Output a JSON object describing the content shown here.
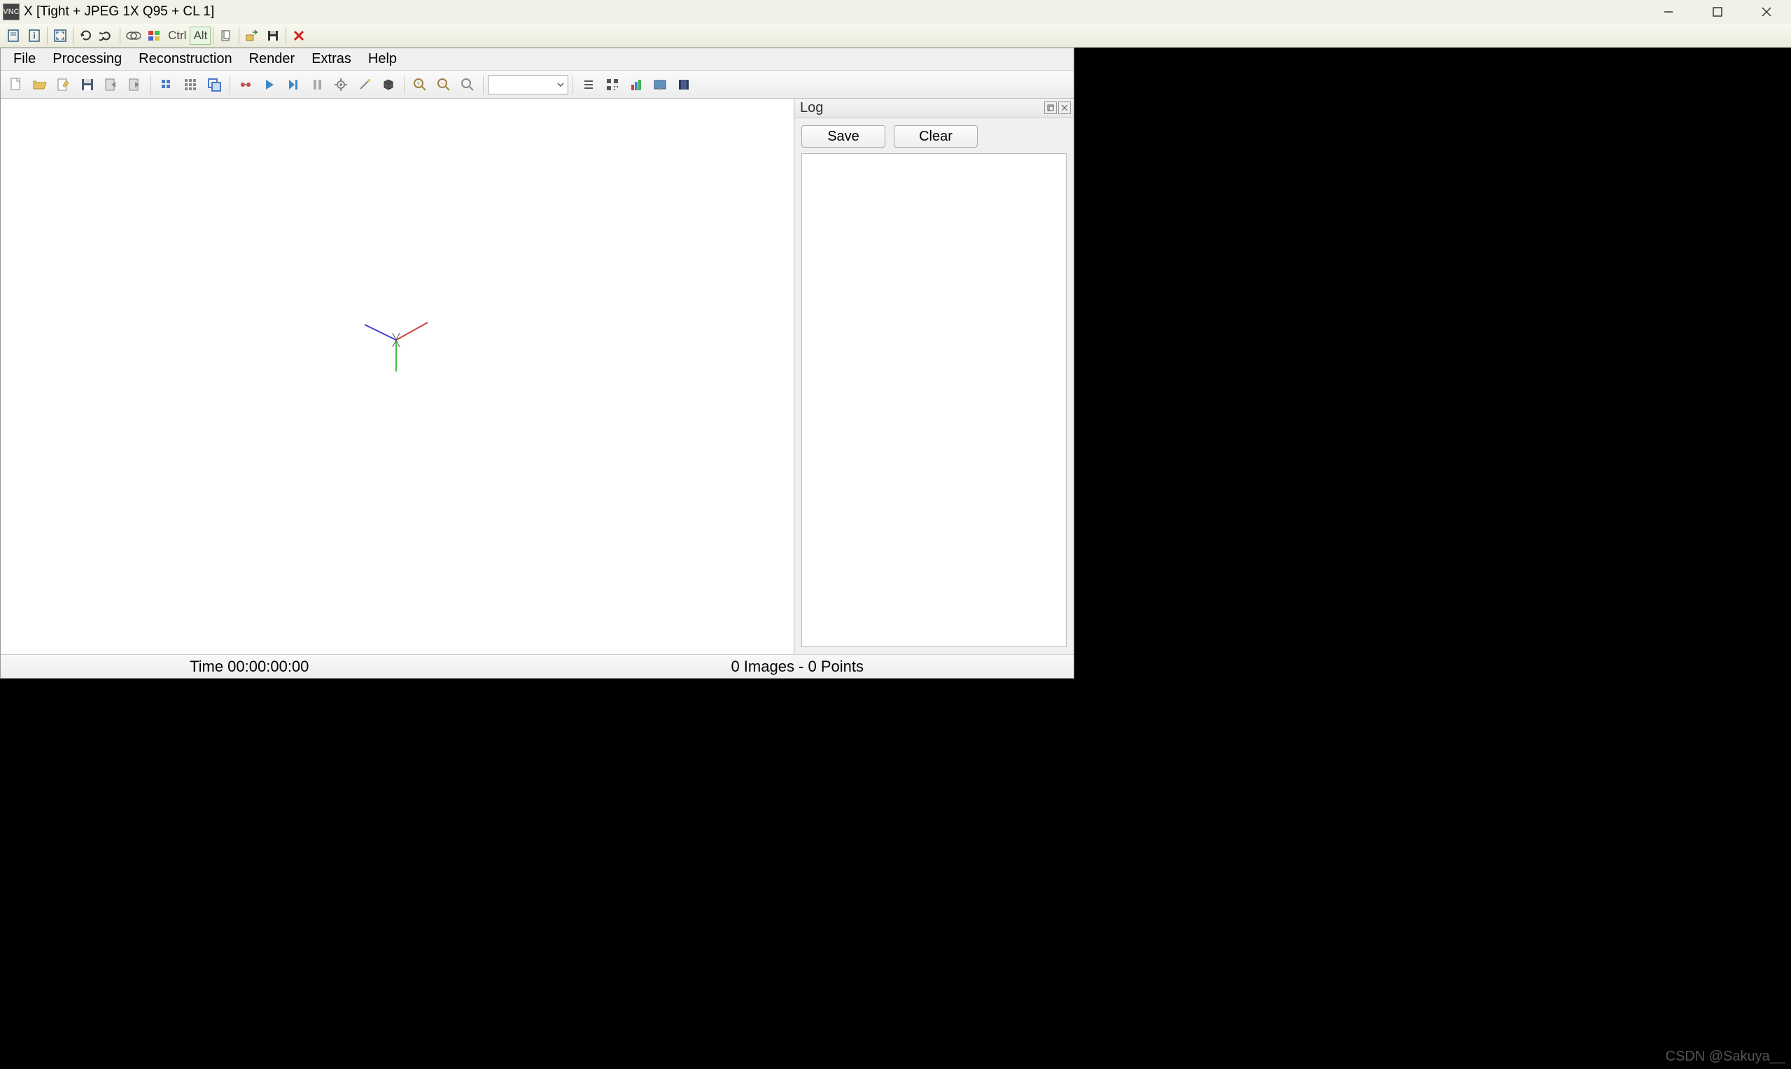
{
  "titlebar": {
    "title": "X [Tight + JPEG 1X Q95 + CL 1]",
    "icon_label": "VNC"
  },
  "system_toolbar": {
    "ctrl": "Ctrl",
    "alt": "Alt"
  },
  "menu": {
    "file": "File",
    "processing": "Processing",
    "reconstruction": "Reconstruction",
    "render": "Render",
    "extras": "Extras",
    "help": "Help"
  },
  "log_panel": {
    "title": "Log",
    "save": "Save",
    "clear": "Clear"
  },
  "statusbar": {
    "time": "Time 00:00:00:00",
    "info": "0 Images - 0 Points"
  },
  "watermark": "CSDN @Sakuya__",
  "colors": {
    "axis_x": "#d04040",
    "axis_y": "#40c040",
    "axis_z": "#4040d0"
  }
}
